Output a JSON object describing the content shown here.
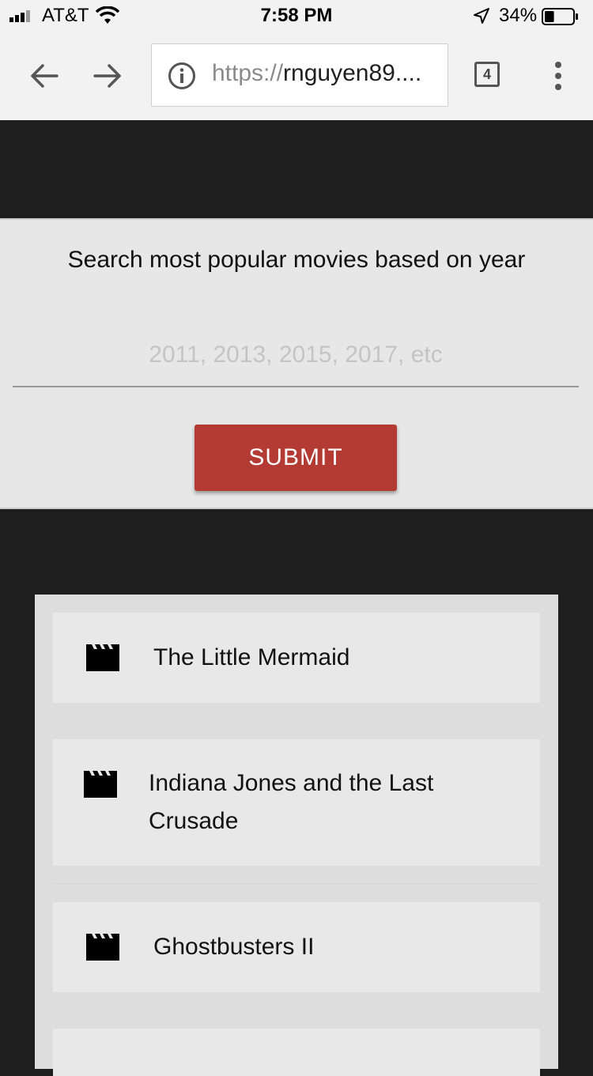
{
  "status_bar": {
    "carrier": "AT&T",
    "time": "7:58 PM",
    "battery": "34%",
    "battery_level": 0.34
  },
  "browser": {
    "url_scheme": "https://",
    "url_host": "rnguyen89....",
    "tab_count": "4"
  },
  "search": {
    "title": "Search most popular movies based on year",
    "placeholder": "2011, 2013, 2015, 2017, etc",
    "value": "",
    "submit_label": "SUBMIT"
  },
  "movies": [
    {
      "title": "The Little Mermaid",
      "icon": "movie-clapperboard-icon"
    },
    {
      "title": "Indiana Jones and the Last Crusade",
      "icon": "movie-clapperboard-icon"
    },
    {
      "title": "Ghostbusters II",
      "icon": "movie-clapperboard-icon"
    }
  ],
  "colors": {
    "accent": "#b33b34",
    "dark_bg": "#1e1e1e",
    "panel_bg": "#e7e7e7"
  }
}
